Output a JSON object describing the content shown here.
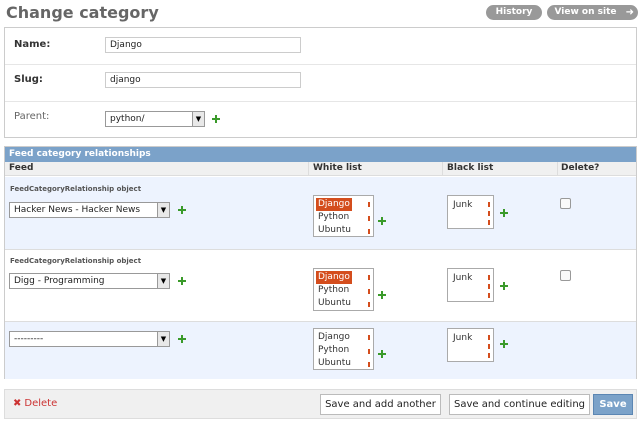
{
  "header": {
    "title": "Change category",
    "history_label": "History",
    "view_on_site_label": "View on site"
  },
  "form": {
    "name_label": "Name:",
    "name_value": "Django",
    "slug_label": "Slug:",
    "slug_value": "django",
    "parent_label": "Parent:",
    "parent_value": "python/"
  },
  "inline": {
    "caption": "Feed category relationships",
    "columns": [
      "Feed",
      "White list",
      "Black list",
      "Delete?"
    ],
    "object_label": "FeedCategoryRelationship object",
    "rows": [
      {
        "object_label": "FeedCategoryRelationship object",
        "feed": "Hacker News - Hacker News",
        "white_list": [
          "Django",
          "Python",
          "Ubuntu"
        ],
        "white_selected": [
          "Django"
        ],
        "black_list": [
          "Junk"
        ],
        "delete_checked": false
      },
      {
        "object_label": "FeedCategoryRelationship object",
        "feed": "Digg - Programming",
        "white_list": [
          "Django",
          "Python",
          "Ubuntu"
        ],
        "white_selected": [
          "Django"
        ],
        "black_list": [
          "Junk"
        ],
        "delete_checked": false
      },
      {
        "object_label": "",
        "feed": "---------",
        "white_list": [
          "Django",
          "Python",
          "Ubuntu"
        ],
        "white_selected": [],
        "black_list": [
          "Junk"
        ]
      }
    ]
  },
  "submit": {
    "delete_label": "Delete",
    "save_add_label": "Save and add another",
    "save_continue_label": "Save and continue editing",
    "save_label": "Save"
  },
  "colors": {
    "accent": "#7ba2c9",
    "selected_option": "#d44d1d",
    "add_icon": "#3a9a2a",
    "delete_link": "#cc3333"
  }
}
